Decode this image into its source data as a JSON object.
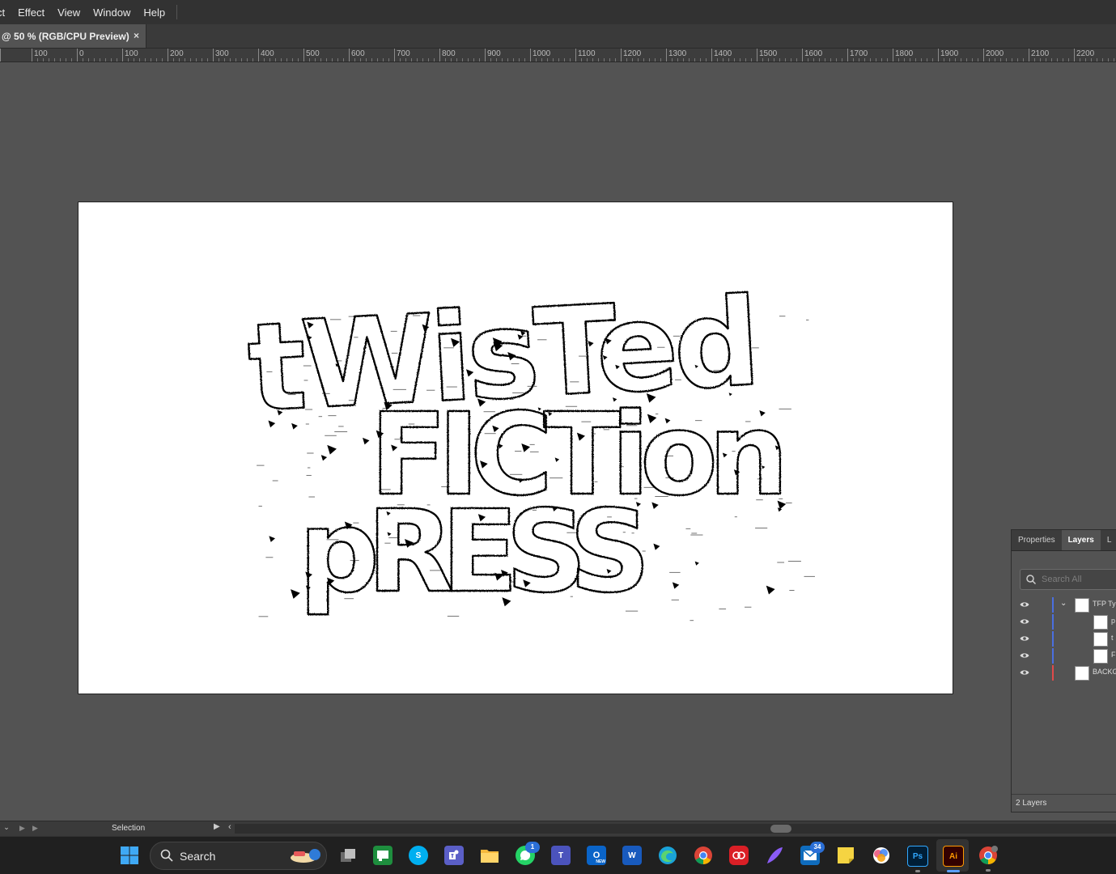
{
  "menu": {
    "items": [
      "ct",
      "Effect",
      "View",
      "Window",
      "Help"
    ]
  },
  "document_tab": {
    "title": "@ 50 % (RGB/CPU Preview)",
    "close_glyph": "×"
  },
  "ruler": {
    "labels": [
      "100",
      "0",
      "100",
      "200",
      "300",
      "400",
      "500",
      "600",
      "700",
      "800",
      "900",
      "1000",
      "1100",
      "1200",
      "1300",
      "1400",
      "1500",
      "1600",
      "1700",
      "1800",
      "1900",
      "2000",
      "2100",
      "2200"
    ]
  },
  "artwork": {
    "line1": "tWisTed",
    "line2": "FICTion",
    "line3": "pRESS"
  },
  "layers_panel": {
    "tabs": [
      "Properties",
      "Layers",
      "L"
    ],
    "active_tab": "Layers",
    "search_placeholder": "Search All",
    "rows": [
      {
        "name": "TFP Ty",
        "color": "#4a6fe0",
        "expanded": true,
        "level": 0
      },
      {
        "name": "p",
        "color": "#4a6fe0",
        "level": 1
      },
      {
        "name": "t",
        "color": "#4a6fe0",
        "level": 1
      },
      {
        "name": "F",
        "color": "#4a6fe0",
        "level": 1
      },
      {
        "name": "BACKG",
        "color": "#e04a4a",
        "level": 0
      }
    ],
    "footer": "2 Layers"
  },
  "status_bar": {
    "zoom_glyph": "⌄",
    "tool_name": "Selection"
  },
  "taskbar": {
    "search_label": "Search",
    "whatsapp_badge": "1",
    "mail_badge": "34",
    "outlook_sub": "NEW",
    "word_glyph": "W",
    "teams_glyph": "T",
    "ps_glyph": "Ps",
    "ai_glyph": "Ai",
    "outlook_glyph": "O",
    "skype_glyph": "S"
  }
}
